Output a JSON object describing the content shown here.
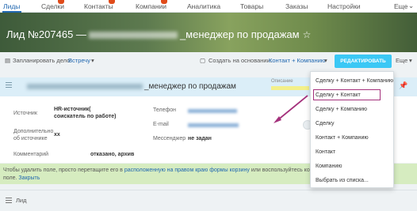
{
  "nav": {
    "tabs": [
      "Лиды",
      "Сделки",
      "Контакты",
      "Компании",
      "Аналитика",
      "Товары",
      "Заказы",
      "Настройки"
    ],
    "more": "Еще"
  },
  "header": {
    "title_prefix": "Лид №207465 —",
    "title_suffix": "_менеджер по продажам"
  },
  "toolbar": {
    "planned_label": "Запланировать дело:",
    "planned_value": "Встречу",
    "create_label": "Создать на основании:",
    "create_value": "Контакт + Компанию",
    "edit_button": "РЕДАКТИРОВАТЬ",
    "more": "Еще"
  },
  "section": {
    "name_suffix": "_менеджер по продажам",
    "caption": "Описание",
    "fields": {
      "source_label": "Источник",
      "source_value": "HR-источник( соискатель по работе)",
      "extra_label": "Дополнительно об источнике",
      "extra_value": "xx",
      "comment_label": "Комментарий",
      "comment_value": "отказано, архив",
      "phone_label": "Телефон",
      "email_label": "E-mail",
      "messenger_label": "Мессенджер",
      "messenger_value": "не задан"
    }
  },
  "hint": {
    "prefix": "Чтобы удалить поле, просто перетащите его в",
    "link1": "расположенную на правом краю формы корзину",
    "middle": "или воспользуйтесь кон",
    "help_prefix": "поле.",
    "link2": "Закрыть"
  },
  "bottom": {
    "label": "Лид"
  },
  "dropdown": {
    "items": [
      "Сделку + Контакт + Компанию",
      "Сделку + Контакт",
      "Сделку + Компанию",
      "Сделку",
      "Контакт + Компанию",
      "Контакт",
      "Компанию",
      "Выбрать из списка..."
    ]
  },
  "colors": {
    "accent": "#2067b0",
    "button": "#3bc8f5",
    "highlight": "#a4317c",
    "hint_bg": "#d6ecc0"
  }
}
